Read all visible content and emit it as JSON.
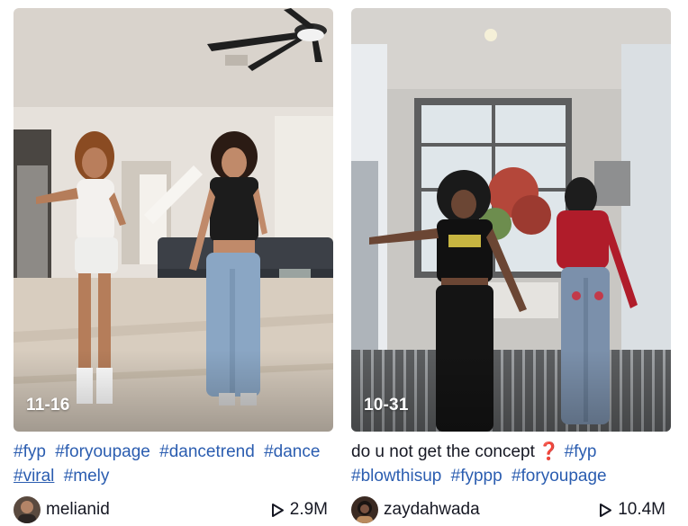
{
  "videos": [
    {
      "date": "11-16",
      "caption_text": "",
      "hashtags": [
        "#fyp",
        "#foryoupage",
        "#dancetrend",
        "#dance",
        "#viral",
        "#mely"
      ],
      "author": "melianid",
      "views": "2.9M"
    },
    {
      "date": "10-31",
      "caption_text": "do u not get the concept",
      "caption_emoji": "❓",
      "hashtags": [
        "#fyp",
        "#blowthisup",
        "#fyppp",
        "#foryoupage"
      ],
      "author": "zaydahwada",
      "views": "10.4M"
    }
  ],
  "icons": {
    "views": "play-icon"
  },
  "colors": {
    "hashtag": "#2b5db0",
    "text": "#161823",
    "emoji_red": "#e23a3a"
  }
}
